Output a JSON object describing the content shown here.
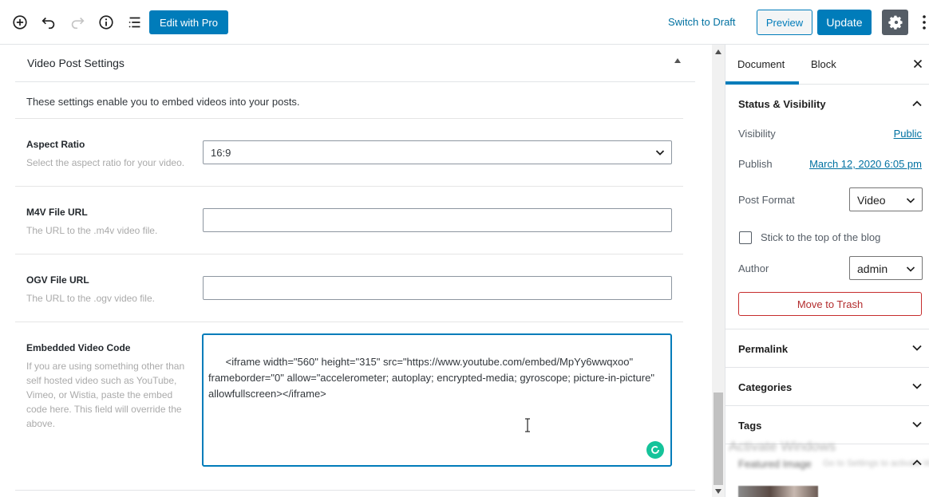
{
  "toolbar": {
    "edit_with_pro": "Edit with Pro",
    "switch_to_draft": "Switch to Draft",
    "preview": "Preview",
    "update": "Update"
  },
  "panel": {
    "title": "Video Post Settings",
    "intro": "These settings enable you to embed videos into your posts.",
    "fields": [
      {
        "label": "Aspect Ratio",
        "description": "Select the aspect ratio for your video.",
        "value": "16:9"
      },
      {
        "label": "M4V File URL",
        "description": "The URL to the .m4v video file.",
        "value": ""
      },
      {
        "label": "OGV File URL",
        "description": "The URL to the .ogv video file.",
        "value": ""
      },
      {
        "label": "Embedded Video Code",
        "description": "If you are using something other than self hosted video such as YouTube, Vimeo, or Wistia, paste the embed code here. This field will override the above.",
        "value": "<iframe width=\"560\" height=\"315\" src=\"https://www.youtube.com/embed/MpYy6wwqxoo\" frameborder=\"0\" allow=\"accelerometer; autoplay; encrypted-media; gyroscope; picture-in-picture\" allowfullscreen></iframe>"
      }
    ]
  },
  "sidebar": {
    "tabs": [
      "Document",
      "Block"
    ],
    "status_section": {
      "title": "Status & Visibility",
      "visibility_label": "Visibility",
      "visibility_value": "Public",
      "publish_label": "Publish",
      "publish_value": "March 12, 2020 6:05 pm",
      "post_format_label": "Post Format",
      "post_format_value": "Video",
      "sticky_label": "Stick to the top of the blog",
      "author_label": "Author",
      "author_value": "admin",
      "trash_label": "Move to Trash"
    },
    "sections": [
      "Permalink",
      "Categories",
      "Tags"
    ],
    "featured_image_title": "Featured Image",
    "watermark": "Activate Windows",
    "watermark_sub": "Go to Settings to activate Windows."
  },
  "colors": {
    "accent": "#007cba",
    "danger": "#b32d2e",
    "grammarly": "#15c39a"
  }
}
